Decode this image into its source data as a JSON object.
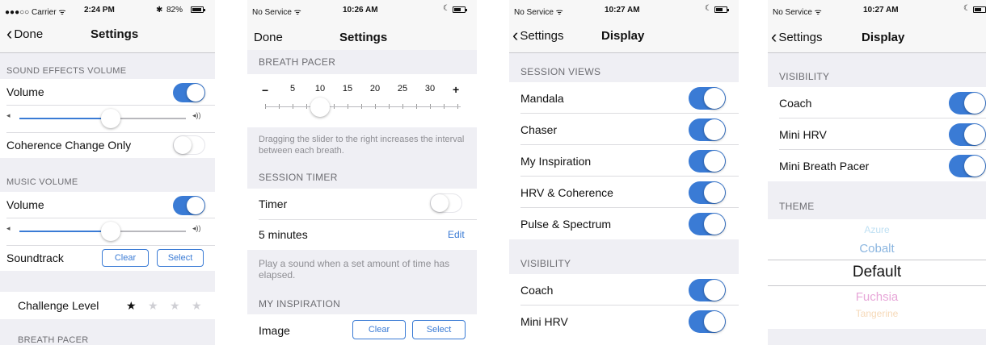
{
  "screen1": {
    "status": {
      "carrier": "●●●○○ Carrier ᯤ",
      "time": "2:24 PM",
      "battery": "82%"
    },
    "nav": {
      "back": "Done",
      "title": "Settings"
    },
    "sound_effects": {
      "header": "SOUND EFFECTS VOLUME",
      "volume_label": "Volume",
      "volume_on": true,
      "volume_level": 0.55,
      "coherence_label": "Coherence Change Only",
      "coherence_on": false
    },
    "music": {
      "header": "MUSIC VOLUME",
      "volume_label": "Volume",
      "volume_on": true,
      "volume_level": 0.55,
      "soundtrack_label": "Soundtrack",
      "clear": "Clear",
      "select": "Select"
    },
    "challenge": {
      "label": "Challenge Level",
      "stars_filled": 1,
      "stars_total": 4
    },
    "next_header": "BREATH PACER"
  },
  "screen2": {
    "status": {
      "carrier": "No Service ᯤ",
      "time": "10:26 AM"
    },
    "nav": {
      "back": "Done",
      "title": "Settings"
    },
    "pacer": {
      "header": "BREATH PACER",
      "minus": "−",
      "plus": "+",
      "ticks": [
        "5",
        "10",
        "15",
        "20",
        "25",
        "30"
      ],
      "value": 10,
      "footer": "Dragging the slider to the right increases the interval between each breath."
    },
    "timer": {
      "header": "SESSION TIMER",
      "timer_label": "Timer",
      "timer_on": false,
      "duration": "5 minutes",
      "edit": "Edit",
      "footer": "Play a sound when a set amount of time has elapsed."
    },
    "inspiration": {
      "header": "MY INSPIRATION",
      "image_label": "Image",
      "clear": "Clear",
      "select": "Select"
    }
  },
  "screen3": {
    "status": {
      "carrier": "No Service ᯤ",
      "time": "10:27 AM"
    },
    "nav": {
      "back": "Settings",
      "title": "Display"
    },
    "session_views": {
      "header": "SESSION VIEWS",
      "items": [
        {
          "label": "Mandala",
          "on": true
        },
        {
          "label": "Chaser",
          "on": true
        },
        {
          "label": "My Inspiration",
          "on": true
        },
        {
          "label": "HRV & Coherence",
          "on": true
        },
        {
          "label": "Pulse & Spectrum",
          "on": true
        }
      ]
    },
    "visibility": {
      "header": "VISIBILITY",
      "items": [
        {
          "label": "Coach",
          "on": true
        },
        {
          "label": "Mini HRV",
          "on": true
        }
      ]
    }
  },
  "screen4": {
    "status": {
      "carrier": "No Service ᯤ",
      "time": "10:27 AM"
    },
    "nav": {
      "back": "Settings",
      "title": "Display"
    },
    "visibility": {
      "header": "VISIBILITY",
      "items": [
        {
          "label": "Coach",
          "on": true
        },
        {
          "label": "Mini HRV",
          "on": true
        },
        {
          "label": "Mini Breath Pacer",
          "on": true
        }
      ]
    },
    "theme": {
      "header": "THEME",
      "options": [
        "Azure",
        "Cobalt",
        "Default",
        "Fuchsia",
        "Tangerine"
      ],
      "selected": "Default",
      "colors": {
        "Azure": "#bfe0f3",
        "Cobalt": "#8bb6e0",
        "Default": "#111111",
        "Fuchsia": "#e7a6d8",
        "Tangerine": "#f6d9b8"
      }
    }
  },
  "colors": {
    "accent": "#3a7bd5",
    "background": "#efeff4"
  }
}
